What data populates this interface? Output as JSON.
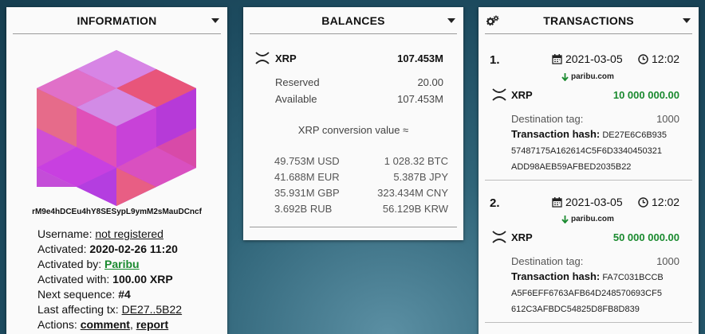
{
  "information": {
    "title": "INFORMATION",
    "address": "rM9e4hDCEu4hY8SESypL9ymM2sMauDCncf",
    "username_label": "Username:",
    "username_value": "not registered",
    "activated_label": "Activated:",
    "activated_value": "2020-02-26 11:20",
    "activated_by_label": "Activated by:",
    "activated_by_value": "Paribu",
    "activated_with_label": "Activated with:",
    "activated_with_value": "100.00 XRP",
    "next_seq_label": "Next sequence:",
    "next_seq_value": "#4",
    "last_tx_label": "Last affecting tx:",
    "last_tx_value": "DE27..5B22",
    "actions_label": "Actions:",
    "action_comment": "comment",
    "action_sep": ",",
    "action_report": "report"
  },
  "balances": {
    "title": "BALANCES",
    "currency": "XRP",
    "total": "107.453M",
    "reserved_label": "Reserved",
    "reserved_value": "20.00",
    "available_label": "Available",
    "available_value": "107.453M",
    "conversion_title": "XRP conversion value ≈",
    "conversions": [
      {
        "left": "49.753M USD",
        "right": "1 028.32 BTC"
      },
      {
        "left": "41.688M EUR",
        "right": "5.387B JPY"
      },
      {
        "left": "35.931M GBP",
        "right": "323.434M CNY"
      },
      {
        "left": "3.692B RUB",
        "right": "56.129B KRW"
      }
    ]
  },
  "transactions": {
    "title": "TRANSACTIONS",
    "items": [
      {
        "num": "1.",
        "date": "2021-03-05",
        "time": "12:02",
        "source": "paribu.com",
        "currency": "XRP",
        "amount": "10 000 000.00",
        "dest_tag_label": "Destination tag:",
        "dest_tag_value": "1000",
        "hash_label": "Transaction hash:",
        "hash_line1": "DE27E6C6B935",
        "hash_line2": "57487175A162614C5F6D3340450321",
        "hash_line3": "ADD98AEB59AFBED2035B22"
      },
      {
        "num": "2.",
        "date": "2021-03-05",
        "time": "12:02",
        "source": "paribu.com",
        "currency": "XRP",
        "amount": "50 000 000.00",
        "dest_tag_label": "Destination tag:",
        "dest_tag_value": "1000",
        "hash_label": "Transaction hash:",
        "hash_line1": "FA7C031BCCB",
        "hash_line2": "A5F6EFF6763AFB64D248570693CF5",
        "hash_line3": "612C3AFBDC54825D8FB8D839"
      }
    ]
  },
  "icons": {
    "xrp": "xrp-logo-icon",
    "calendar": "calendar-icon",
    "clock": "clock-icon",
    "arrow": "arrow-down-icon",
    "gears": "gears-icon",
    "caret": "caret-down-icon"
  },
  "colors": {
    "green": "#1a8a2f",
    "identicon_magenta": "#c43cdc",
    "identicon_pink": "#e8557a"
  }
}
